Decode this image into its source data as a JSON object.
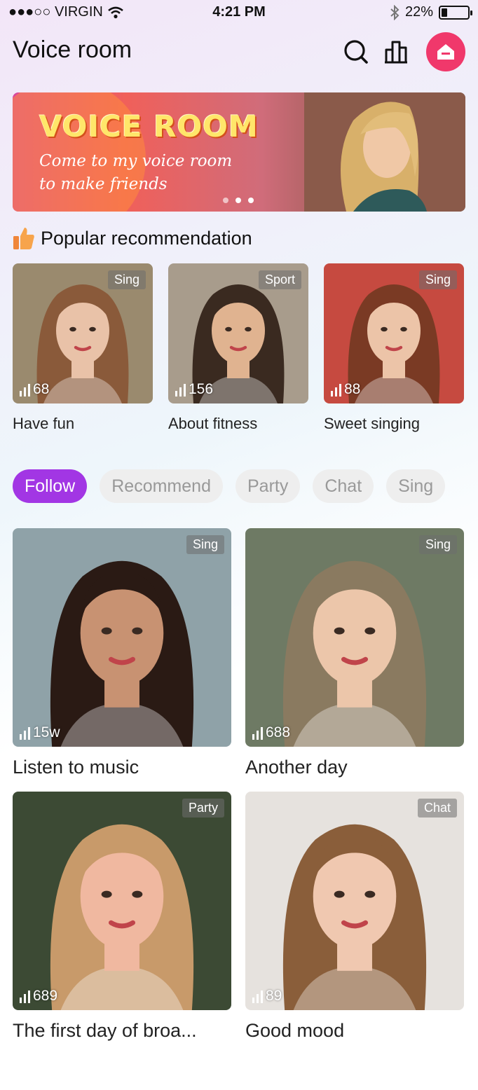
{
  "status_bar": {
    "carrier": "●●●○○ VIRGIN",
    "time": "4:21 PM",
    "battery": "22%",
    "battery_level": 0.22
  },
  "header": {
    "title": "Voice room"
  },
  "banner": {
    "title": "VOICE ROOM",
    "subtitle": "Come to my voice room\nto make friends",
    "slide_count": 3,
    "active_slide": 2
  },
  "section": {
    "title": "Popular recommendation"
  },
  "popular": [
    {
      "title": "Have fun",
      "tag": "Sing",
      "count": "68",
      "bg": "#9a8a6e",
      "skin": "#e9c2a8",
      "hair": "#8a5a3a"
    },
    {
      "title": "About fitness",
      "tag": "Sport",
      "count": "156",
      "bg": "#a89c8c",
      "skin": "#e0b390",
      "hair": "#3a2a20"
    },
    {
      "title": "Sweet singing",
      "tag": "Sing",
      "count": "88",
      "bg": "#c64a40",
      "skin": "#ecc4a8",
      "hair": "#7a3a24"
    }
  ],
  "tabs": [
    {
      "label": "Follow",
      "active": true
    },
    {
      "label": "Recommend",
      "active": false
    },
    {
      "label": "Party",
      "active": false
    },
    {
      "label": "Chat",
      "active": false
    },
    {
      "label": "Sing",
      "active": false
    }
  ],
  "rooms": [
    {
      "title": "Listen to music",
      "tag": "Sing",
      "count": "15w",
      "bg": "#8fa2a8",
      "skin": "#c89272",
      "hair": "#2a1a14"
    },
    {
      "title": "Another day",
      "tag": "Sing",
      "count": "688",
      "bg": "#6e7a64",
      "skin": "#ecc6aa",
      "hair": "#8a7a60"
    },
    {
      "title": "The first day of broa...",
      "tag": "Party",
      "count": "689",
      "bg": "#3c4a34",
      "skin": "#f0b8a0",
      "hair": "#c89a6a"
    },
    {
      "title": "Good mood",
      "tag": "Chat",
      "count": "89",
      "bg": "#e6e2de",
      "skin": "#f0c8b0",
      "hair": "#8a5e3a"
    }
  ],
  "colors": {
    "accent_purple": "#a236e4",
    "home_pink": "#f0386b"
  }
}
